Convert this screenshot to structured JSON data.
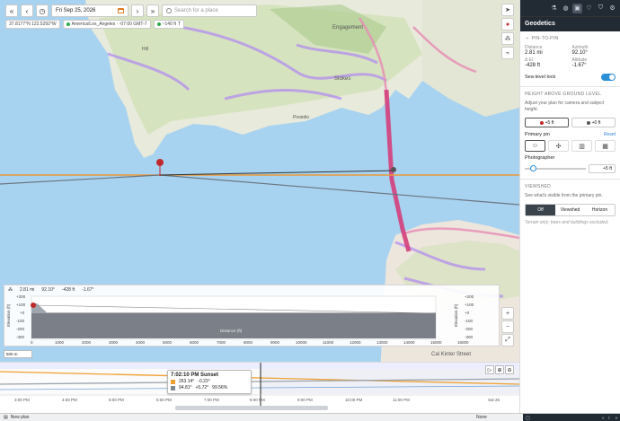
{
  "toolbar": {
    "back_label": "«",
    "prev_label": "‹",
    "clock_icon": "clock-icon",
    "date": "Fri Sep 25, 2026",
    "next_label": "›",
    "forward_label": "»",
    "search_placeholder": "Search for a place"
  },
  "infobar": {
    "coords": "37.8177°N 122.5292°W",
    "timezone": "America/Los_Angeles · -07:00 GMT-7",
    "elevation": "~140 ft",
    "terrain_flag": "T"
  },
  "map": {
    "place_engrossamento": "Engagement",
    "place_stokes": "Stokes",
    "place_hill": "Hill",
    "place_park": "Presidio",
    "water_color": "#a8d3f0",
    "route_color": "#d43f7b",
    "credit": "Cal Kinter Street"
  },
  "panel": {
    "tabs": [
      "flask",
      "globe",
      "geodetics",
      "heart",
      "shield",
      "gear"
    ],
    "title": "Geodetics",
    "pin_to_pin": "PIN-TO-PIN",
    "distance_label": "Distance",
    "distance": "2.81 mi",
    "azimuth_label": "Azimuth",
    "azimuth": "92.10°",
    "delta_el_label": "Δ El.",
    "delta_el": "-428 ft",
    "altitude_label": "Altitude",
    "altitude": "-1.67°",
    "sea_level_lock": "Sea-level lock",
    "hagl_header": "HEIGHT ABOVE GROUND LEVEL",
    "hagl_desc": "Adjust your plan for camera and subject height.",
    "pin_a_height": "+5 ft",
    "pin_b_height": "+0 ft",
    "primary_pin": "Primary pin",
    "reset": "Reset",
    "photographer": "Photographer",
    "photographer_height": "+5 ft",
    "viewshed_header": "VIEWSHED",
    "viewshed_desc": "See what's visible from the primary pin.",
    "viewshed_off": "Off",
    "viewshed_on": "Viewshed",
    "viewshed_horizon": "Horizon",
    "terrain_note": "Terrain only; trees and buildings excluded."
  },
  "profile": {
    "distance": "2.81 mi",
    "azimuth": "92.10°",
    "delta": "-428 ft",
    "angle": "-1.67°",
    "y_ticks": [
      "+200",
      "+100",
      "+0",
      "-100",
      "-200",
      "-300"
    ],
    "y_ticks_right": [
      "+200",
      "+100",
      "+0",
      "-100",
      "-200",
      "-300"
    ],
    "x_ticks": [
      "0",
      "1000",
      "2000",
      "3000",
      "4000",
      "5000",
      "6000",
      "7000",
      "8000",
      "9000",
      "10000",
      "11000",
      "12000",
      "13000",
      "14000",
      "15000",
      "16000"
    ],
    "x_label": "Distance (ft)",
    "y_label_left": "Elevation (ft)",
    "y_label_right": "Elevation (ft)"
  },
  "scale": "500 m",
  "timeline": {
    "ticks": [
      "3:00 PM",
      "4:00 PM",
      "5:00 PM",
      "6:00 PM",
      "7:00 PM",
      "8:00 PM",
      "9:00 PM",
      "10:00 PM",
      "11:00 PM",
      "Sat 26"
    ],
    "tooltip_title": "7:02:10 PM Sunset",
    "sun_az": "263.14°",
    "sun_alt": "-0.23°",
    "moon_az": "94.81°",
    "moon_alt": "+5.72°",
    "moon_pct": "99.56%",
    "sun_color": "#f0a030",
    "moon_color": "#7d8790"
  },
  "bottom": {
    "new_plan": "New plan",
    "none_label": "None"
  }
}
